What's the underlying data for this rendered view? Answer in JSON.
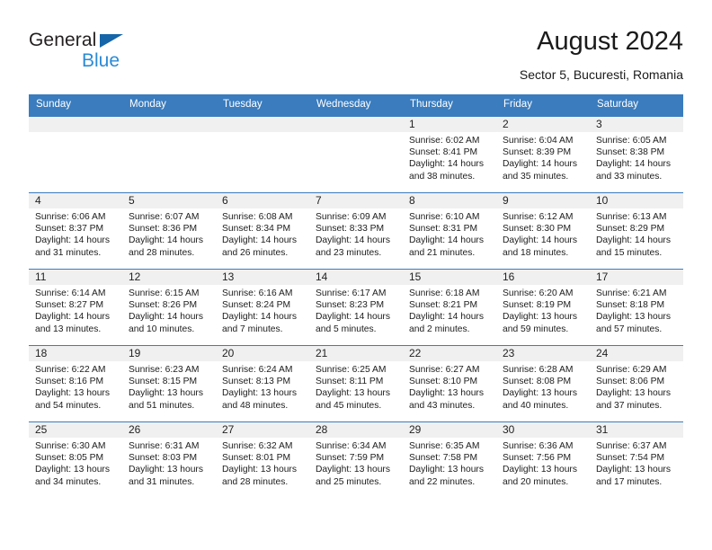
{
  "brand": {
    "line1": "General",
    "line2": "Blue",
    "triangle_color": "#1565a8",
    "blue_text_color": "#2b8ad6"
  },
  "header": {
    "title": "August 2024",
    "subtitle": "Sector 5, Bucuresti, Romania"
  },
  "theme": {
    "header_bar_color": "#3a7cbe",
    "daynum_band_color": "#f0f0f0",
    "row_divider_color": "#3a7cbe"
  },
  "weekday_headers": [
    "Sunday",
    "Monday",
    "Tuesday",
    "Wednesday",
    "Thursday",
    "Friday",
    "Saturday"
  ],
  "labels": {
    "sunrise_prefix": "Sunrise:",
    "sunset_prefix": "Sunset:",
    "daylight_prefix": "Daylight:"
  },
  "weeks": [
    [
      {
        "day": "",
        "empty": true
      },
      {
        "day": "",
        "empty": true
      },
      {
        "day": "",
        "empty": true
      },
      {
        "day": "",
        "empty": true
      },
      {
        "day": "1",
        "sunrise": "Sunrise: 6:02 AM",
        "sunset": "Sunset: 8:41 PM",
        "daylight": "Daylight: 14 hours and 38 minutes."
      },
      {
        "day": "2",
        "sunrise": "Sunrise: 6:04 AM",
        "sunset": "Sunset: 8:39 PM",
        "daylight": "Daylight: 14 hours and 35 minutes."
      },
      {
        "day": "3",
        "sunrise": "Sunrise: 6:05 AM",
        "sunset": "Sunset: 8:38 PM",
        "daylight": "Daylight: 14 hours and 33 minutes."
      }
    ],
    [
      {
        "day": "4",
        "sunrise": "Sunrise: 6:06 AM",
        "sunset": "Sunset: 8:37 PM",
        "daylight": "Daylight: 14 hours and 31 minutes."
      },
      {
        "day": "5",
        "sunrise": "Sunrise: 6:07 AM",
        "sunset": "Sunset: 8:36 PM",
        "daylight": "Daylight: 14 hours and 28 minutes."
      },
      {
        "day": "6",
        "sunrise": "Sunrise: 6:08 AM",
        "sunset": "Sunset: 8:34 PM",
        "daylight": "Daylight: 14 hours and 26 minutes."
      },
      {
        "day": "7",
        "sunrise": "Sunrise: 6:09 AM",
        "sunset": "Sunset: 8:33 PM",
        "daylight": "Daylight: 14 hours and 23 minutes."
      },
      {
        "day": "8",
        "sunrise": "Sunrise: 6:10 AM",
        "sunset": "Sunset: 8:31 PM",
        "daylight": "Daylight: 14 hours and 21 minutes."
      },
      {
        "day": "9",
        "sunrise": "Sunrise: 6:12 AM",
        "sunset": "Sunset: 8:30 PM",
        "daylight": "Daylight: 14 hours and 18 minutes."
      },
      {
        "day": "10",
        "sunrise": "Sunrise: 6:13 AM",
        "sunset": "Sunset: 8:29 PM",
        "daylight": "Daylight: 14 hours and 15 minutes."
      }
    ],
    [
      {
        "day": "11",
        "sunrise": "Sunrise: 6:14 AM",
        "sunset": "Sunset: 8:27 PM",
        "daylight": "Daylight: 14 hours and 13 minutes."
      },
      {
        "day": "12",
        "sunrise": "Sunrise: 6:15 AM",
        "sunset": "Sunset: 8:26 PM",
        "daylight": "Daylight: 14 hours and 10 minutes."
      },
      {
        "day": "13",
        "sunrise": "Sunrise: 6:16 AM",
        "sunset": "Sunset: 8:24 PM",
        "daylight": "Daylight: 14 hours and 7 minutes."
      },
      {
        "day": "14",
        "sunrise": "Sunrise: 6:17 AM",
        "sunset": "Sunset: 8:23 PM",
        "daylight": "Daylight: 14 hours and 5 minutes."
      },
      {
        "day": "15",
        "sunrise": "Sunrise: 6:18 AM",
        "sunset": "Sunset: 8:21 PM",
        "daylight": "Daylight: 14 hours and 2 minutes."
      },
      {
        "day": "16",
        "sunrise": "Sunrise: 6:20 AM",
        "sunset": "Sunset: 8:19 PM",
        "daylight": "Daylight: 13 hours and 59 minutes."
      },
      {
        "day": "17",
        "sunrise": "Sunrise: 6:21 AM",
        "sunset": "Sunset: 8:18 PM",
        "daylight": "Daylight: 13 hours and 57 minutes."
      }
    ],
    [
      {
        "day": "18",
        "sunrise": "Sunrise: 6:22 AM",
        "sunset": "Sunset: 8:16 PM",
        "daylight": "Daylight: 13 hours and 54 minutes."
      },
      {
        "day": "19",
        "sunrise": "Sunrise: 6:23 AM",
        "sunset": "Sunset: 8:15 PM",
        "daylight": "Daylight: 13 hours and 51 minutes."
      },
      {
        "day": "20",
        "sunrise": "Sunrise: 6:24 AM",
        "sunset": "Sunset: 8:13 PM",
        "daylight": "Daylight: 13 hours and 48 minutes."
      },
      {
        "day": "21",
        "sunrise": "Sunrise: 6:25 AM",
        "sunset": "Sunset: 8:11 PM",
        "daylight": "Daylight: 13 hours and 45 minutes."
      },
      {
        "day": "22",
        "sunrise": "Sunrise: 6:27 AM",
        "sunset": "Sunset: 8:10 PM",
        "daylight": "Daylight: 13 hours and 43 minutes."
      },
      {
        "day": "23",
        "sunrise": "Sunrise: 6:28 AM",
        "sunset": "Sunset: 8:08 PM",
        "daylight": "Daylight: 13 hours and 40 minutes."
      },
      {
        "day": "24",
        "sunrise": "Sunrise: 6:29 AM",
        "sunset": "Sunset: 8:06 PM",
        "daylight": "Daylight: 13 hours and 37 minutes."
      }
    ],
    [
      {
        "day": "25",
        "sunrise": "Sunrise: 6:30 AM",
        "sunset": "Sunset: 8:05 PM",
        "daylight": "Daylight: 13 hours and 34 minutes."
      },
      {
        "day": "26",
        "sunrise": "Sunrise: 6:31 AM",
        "sunset": "Sunset: 8:03 PM",
        "daylight": "Daylight: 13 hours and 31 minutes."
      },
      {
        "day": "27",
        "sunrise": "Sunrise: 6:32 AM",
        "sunset": "Sunset: 8:01 PM",
        "daylight": "Daylight: 13 hours and 28 minutes."
      },
      {
        "day": "28",
        "sunrise": "Sunrise: 6:34 AM",
        "sunset": "Sunset: 7:59 PM",
        "daylight": "Daylight: 13 hours and 25 minutes."
      },
      {
        "day": "29",
        "sunrise": "Sunrise: 6:35 AM",
        "sunset": "Sunset: 7:58 PM",
        "daylight": "Daylight: 13 hours and 22 minutes."
      },
      {
        "day": "30",
        "sunrise": "Sunrise: 6:36 AM",
        "sunset": "Sunset: 7:56 PM",
        "daylight": "Daylight: 13 hours and 20 minutes."
      },
      {
        "day": "31",
        "sunrise": "Sunrise: 6:37 AM",
        "sunset": "Sunset: 7:54 PM",
        "daylight": "Daylight: 13 hours and 17 minutes."
      }
    ]
  ]
}
